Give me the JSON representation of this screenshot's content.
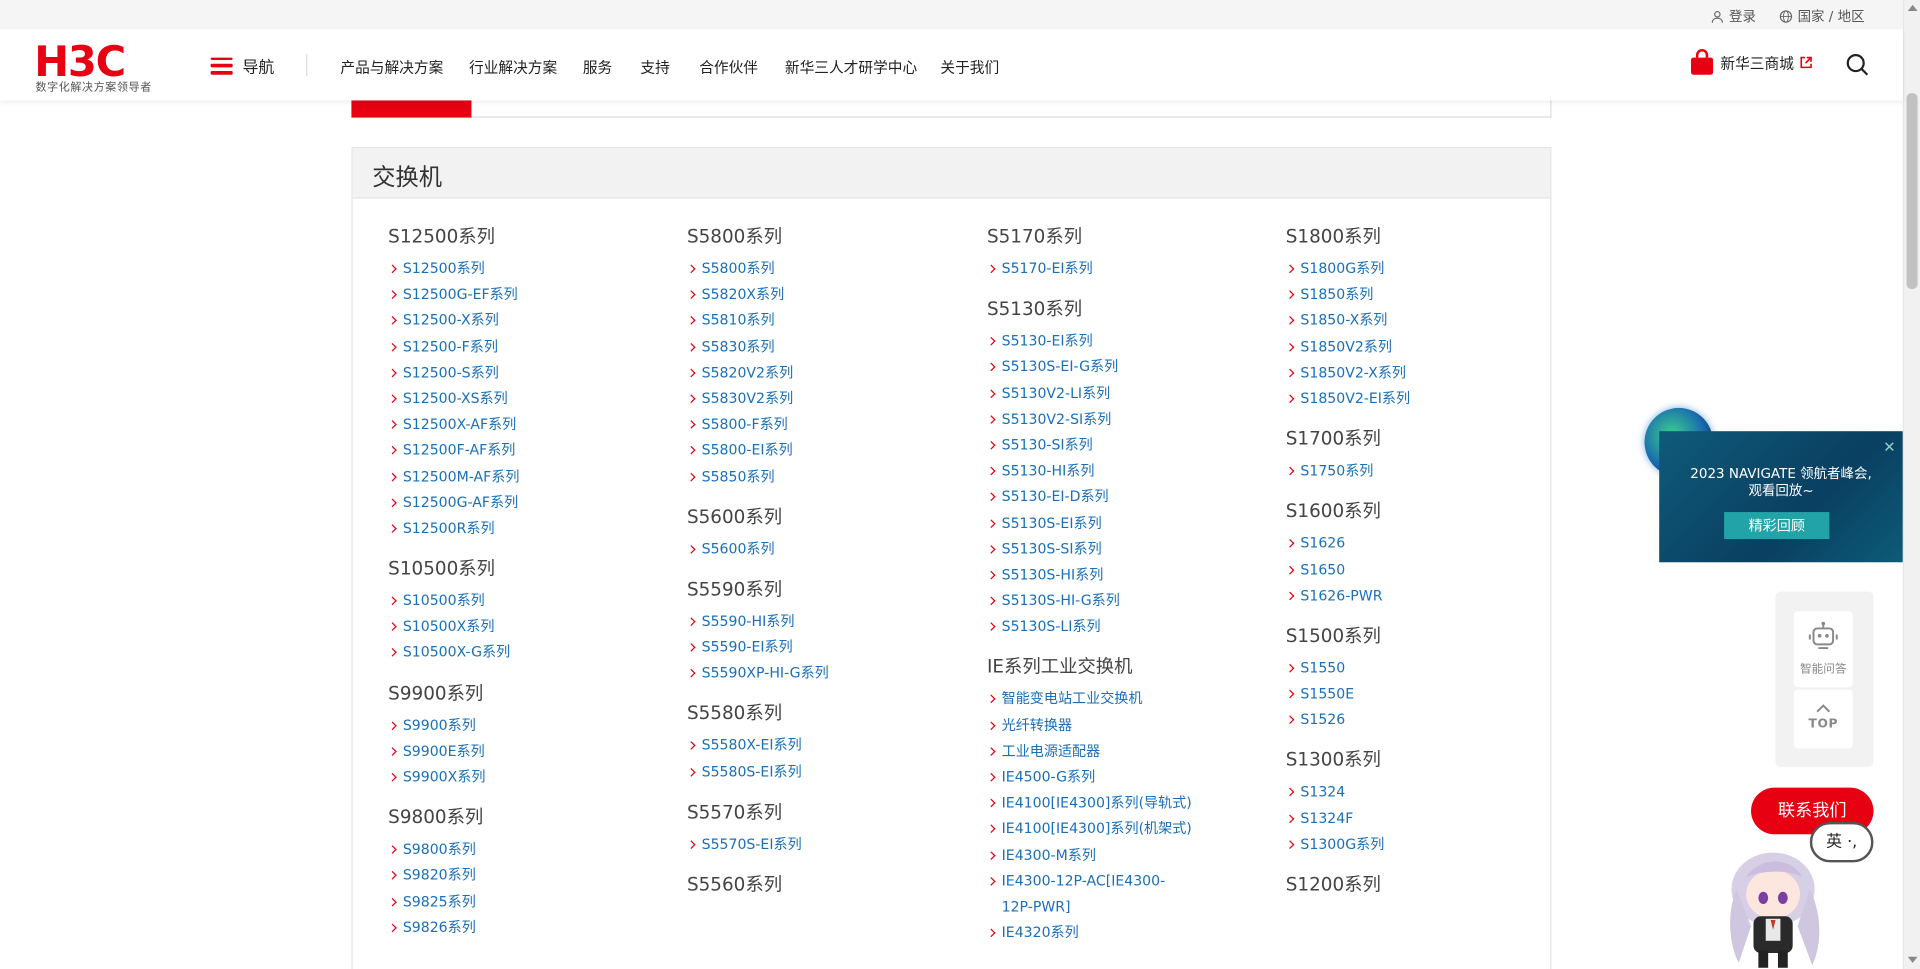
{
  "topbar": {
    "login": "登录",
    "region": "国家 / 地区"
  },
  "header": {
    "logo_text": "H3C",
    "logo_sub": "数字化解决方案领导者",
    "nav_label": "导航",
    "menu": [
      "产品与解决方案",
      "行业解决方案",
      "服务",
      "支持",
      "合作伙伴",
      "新华三人才研学中心",
      "关于我们"
    ],
    "shop_label": "新华三商城"
  },
  "panel": {
    "title": "交换机",
    "columns": [
      [
        {
          "title": "S12500系列",
          "items": [
            "S12500系列",
            "S12500G-EF系列",
            "S12500-X系列",
            "S12500-F系列",
            "S12500-S系列",
            "S12500-XS系列",
            "S12500X-AF系列",
            "S12500F-AF系列",
            "S12500M-AF系列",
            "S12500G-AF系列",
            "S12500R系列"
          ]
        },
        {
          "title": "S10500系列",
          "items": [
            "S10500系列",
            "S10500X系列",
            "S10500X-G系列"
          ]
        },
        {
          "title": "S9900系列",
          "items": [
            "S9900系列",
            "S9900E系列",
            "S9900X系列"
          ]
        },
        {
          "title": "S9800系列",
          "items": [
            "S9800系列",
            "S9820系列",
            "S9825系列",
            "S9826系列"
          ]
        }
      ],
      [
        {
          "title": "S5800系列",
          "items": [
            "S5800系列",
            "S5820X系列",
            "S5810系列",
            "S5830系列",
            "S5820V2系列",
            "S5830V2系列",
            "S5800-F系列",
            "S5800-EI系列",
            "S5850系列"
          ]
        },
        {
          "title": "S5600系列",
          "items": [
            "S5600系列"
          ]
        },
        {
          "title": "S5590系列",
          "items": [
            "S5590-HI系列",
            "S5590-EI系列",
            "S5590XP-HI-G系列"
          ]
        },
        {
          "title": "S5580系列",
          "items": [
            "S5580X-EI系列",
            "S5580S-EI系列"
          ]
        },
        {
          "title": "S5570系列",
          "items": [
            "S5570S-EI系列"
          ]
        },
        {
          "title": "S5560系列",
          "items": []
        }
      ],
      [
        {
          "title": "S5170系列",
          "items": [
            "S5170-EI系列"
          ]
        },
        {
          "title": "S5130系列",
          "items": [
            "S5130-EI系列",
            "S5130S-EI-G系列",
            "S5130V2-LI系列",
            "S5130V2-SI系列",
            "S5130-SI系列",
            "S5130-HI系列",
            "S5130-EI-D系列",
            "S5130S-EI系列",
            "S5130S-SI系列",
            "S5130S-HI系列",
            "S5130S-HI-G系列",
            "S5130S-LI系列"
          ]
        },
        {
          "title": "IE系列工业交换机",
          "items": [
            "智能变电站工业交换机",
            "光纤转换器",
            "工业电源适配器",
            "IE4500-G系列",
            "IE4100[IE4300]系列(导轨式)",
            "IE4100[IE4300]系列(机架式)",
            "IE4300-M系列",
            "IE4300-12P-AC[IE4300-12P-PWR]",
            "IE4320系列"
          ]
        }
      ],
      [
        {
          "title": "S1800系列",
          "items": [
            "S1800G系列",
            "S1850系列",
            "S1850-X系列",
            "S1850V2系列",
            "S1850V2-X系列",
            "S1850V2-EI系列"
          ]
        },
        {
          "title": "S1700系列",
          "items": [
            "S1750系列"
          ]
        },
        {
          "title": "S1600系列",
          "items": [
            "S1626",
            "S1650",
            "S1626-PWR"
          ]
        },
        {
          "title": "S1500系列",
          "items": [
            "S1550",
            "S1550E",
            "S1526"
          ]
        },
        {
          "title": "S1300系列",
          "items": [
            "S1324",
            "S1324F",
            "S1300G系列"
          ]
        },
        {
          "title": "S1200系列",
          "items": []
        }
      ]
    ]
  },
  "promo": {
    "line1": "2023 NAVIGATE 领航者峰会,",
    "line2": "观看回放~",
    "button": "精彩回顾"
  },
  "sidetools": {
    "qa": "智能问答",
    "top": "TOP"
  },
  "contact": {
    "label": "联系我们",
    "lang": "英"
  },
  "colors": {
    "brand_red": "#e60012",
    "link_blue": "#1a6fb8"
  }
}
